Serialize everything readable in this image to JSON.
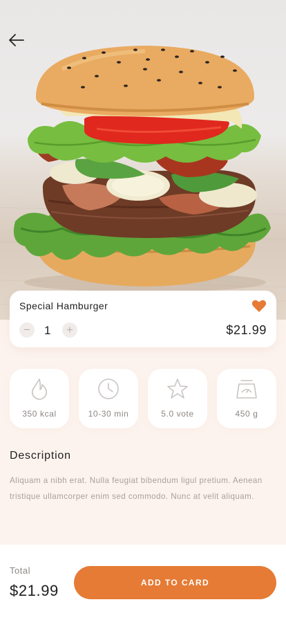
{
  "header": {
    "back_icon": "arrow-left-icon"
  },
  "hero": {
    "image": "hamburger-photo"
  },
  "product": {
    "name": "Special Hamburger",
    "favorite_icon": "heart-icon",
    "favorite_color": "#e57b35",
    "quantity": "1",
    "minus_label": "−",
    "plus_label": "+",
    "price": "$21.99"
  },
  "stats": [
    {
      "icon": "flame-icon",
      "label": "350 kcal"
    },
    {
      "icon": "clock-icon",
      "label": "10-30 min"
    },
    {
      "icon": "star-icon",
      "label": "5.0 vote"
    },
    {
      "icon": "scale-icon",
      "label": "450 g"
    }
  ],
  "description": {
    "title": "Description",
    "text": "Aliquam a nibh erat. Nulla feugiat bibendum ligul pretium. Aenean tristique ullamcorper enim sed commodo. Nunc at velit aliquam."
  },
  "footer": {
    "total_label": "Total",
    "total_value": "$21.99",
    "button_label": "ADD TO CARD"
  },
  "colors": {
    "accent": "#e57b35",
    "background": "#fdf3ee",
    "card": "#ffffff",
    "muted_text": "#a6a09d"
  }
}
